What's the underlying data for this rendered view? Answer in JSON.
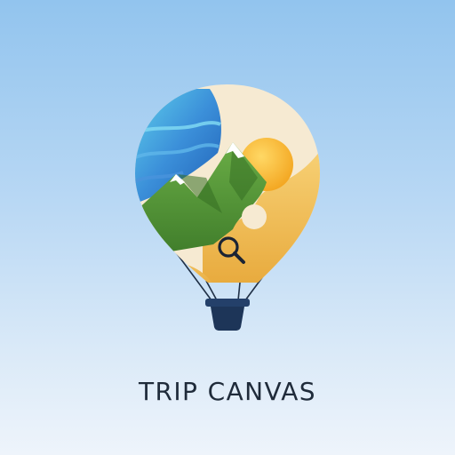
{
  "app": {
    "name": "TRIP CANVAS"
  },
  "logo": {
    "icon": "hot-air-balloon-icon",
    "inner_icons": [
      "mountain-icon",
      "sun-icon",
      "ocean-wave-icon",
      "magnifier-icon"
    ]
  },
  "colors": {
    "background_top": "#92c4ee",
    "background_bottom": "#eef4fb",
    "ocean": "#2f7bd0",
    "mountain": "#5a9a3c",
    "sun": "#f3b72f",
    "balloon_cream": "#f6ead2",
    "basket": "#1d3558",
    "text": "#1f2b3a"
  }
}
